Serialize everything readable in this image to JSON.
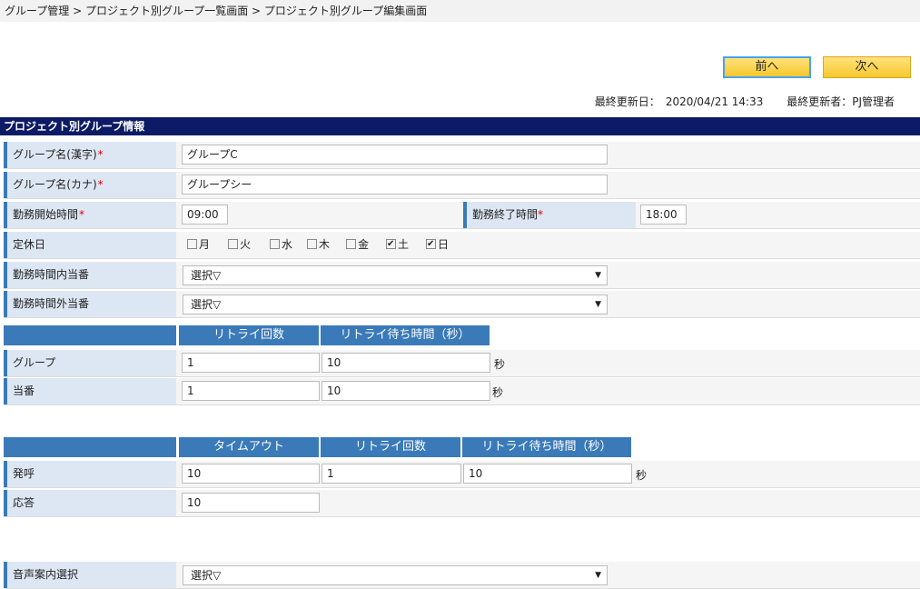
{
  "breadcrumb": "グループ管理 > プロジェクト別グループ一覧画面 > プロジェクト別グループ編集画面",
  "nav": {
    "prev_label": "前へ",
    "next_label": "次へ"
  },
  "meta": {
    "updated_label": "最終更新日：",
    "updated_value": "2020/04/21 14:33",
    "updater_label": "最終更新者：",
    "updater_value": "PJ管理者"
  },
  "section_title": "プロジェクト別グループ情報",
  "form": {
    "group_name_kanji": {
      "label": "グループ名(漢字)",
      "required": "*",
      "value": "グループC"
    },
    "group_name_kana": {
      "label": "グループ名(カナ)",
      "required": "*",
      "value": "グループシー"
    },
    "work_start": {
      "label": "勤務開始時間",
      "required": "*",
      "value": "09:00"
    },
    "work_end": {
      "label": "勤務終了時間",
      "required": "*",
      "value": "18:00"
    },
    "holidays": {
      "label": "定休日",
      "days": [
        {
          "label": "月",
          "checked": false
        },
        {
          "label": "火",
          "checked": false
        },
        {
          "label": "水",
          "checked": false
        },
        {
          "label": "木",
          "checked": false
        },
        {
          "label": "金",
          "checked": false
        },
        {
          "label": "土",
          "checked": true
        },
        {
          "label": "日",
          "checked": true
        }
      ]
    },
    "duty_in_hours": {
      "label": "勤務時間内当番",
      "value": "選択▽",
      "arrow": "▼"
    },
    "duty_out_hours": {
      "label": "勤務時間外当番",
      "value": "選択▽",
      "arrow": "▼"
    }
  },
  "retry_table": {
    "headers": [
      "リトライ回数",
      "リトライ待ち時間（秒）"
    ],
    "rows": [
      {
        "label": "グループ",
        "retry_count": "1",
        "retry_wait": "10",
        "unit": "秒"
      },
      {
        "label": "当番",
        "retry_count": "1",
        "retry_wait": "10",
        "unit": "秒"
      }
    ]
  },
  "call_table": {
    "headers": [
      "タイムアウト",
      "リトライ回数",
      "リトライ待ち時間（秒）"
    ],
    "rows": [
      {
        "label": "発呼",
        "timeout": "10",
        "retry_count": "1",
        "retry_wait": "10",
        "unit": "秒"
      },
      {
        "label": "応答",
        "timeout": "10"
      }
    ]
  },
  "voice_guide": {
    "label": "音声案内選択",
    "value": "選択▽",
    "arrow": "▼"
  }
}
